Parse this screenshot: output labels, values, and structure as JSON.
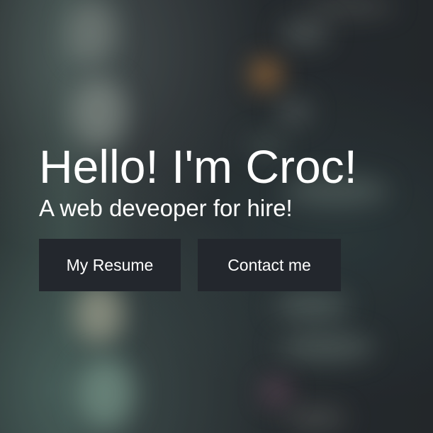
{
  "hero": {
    "title": "Hello! I'm Croc!",
    "subtitle": "A web deveoper for hire!",
    "buttons": {
      "resume_label": "My Resume",
      "contact_label": "Contact me"
    },
    "colors": {
      "button_background": "#23272d",
      "text": "#ffffff"
    }
  }
}
